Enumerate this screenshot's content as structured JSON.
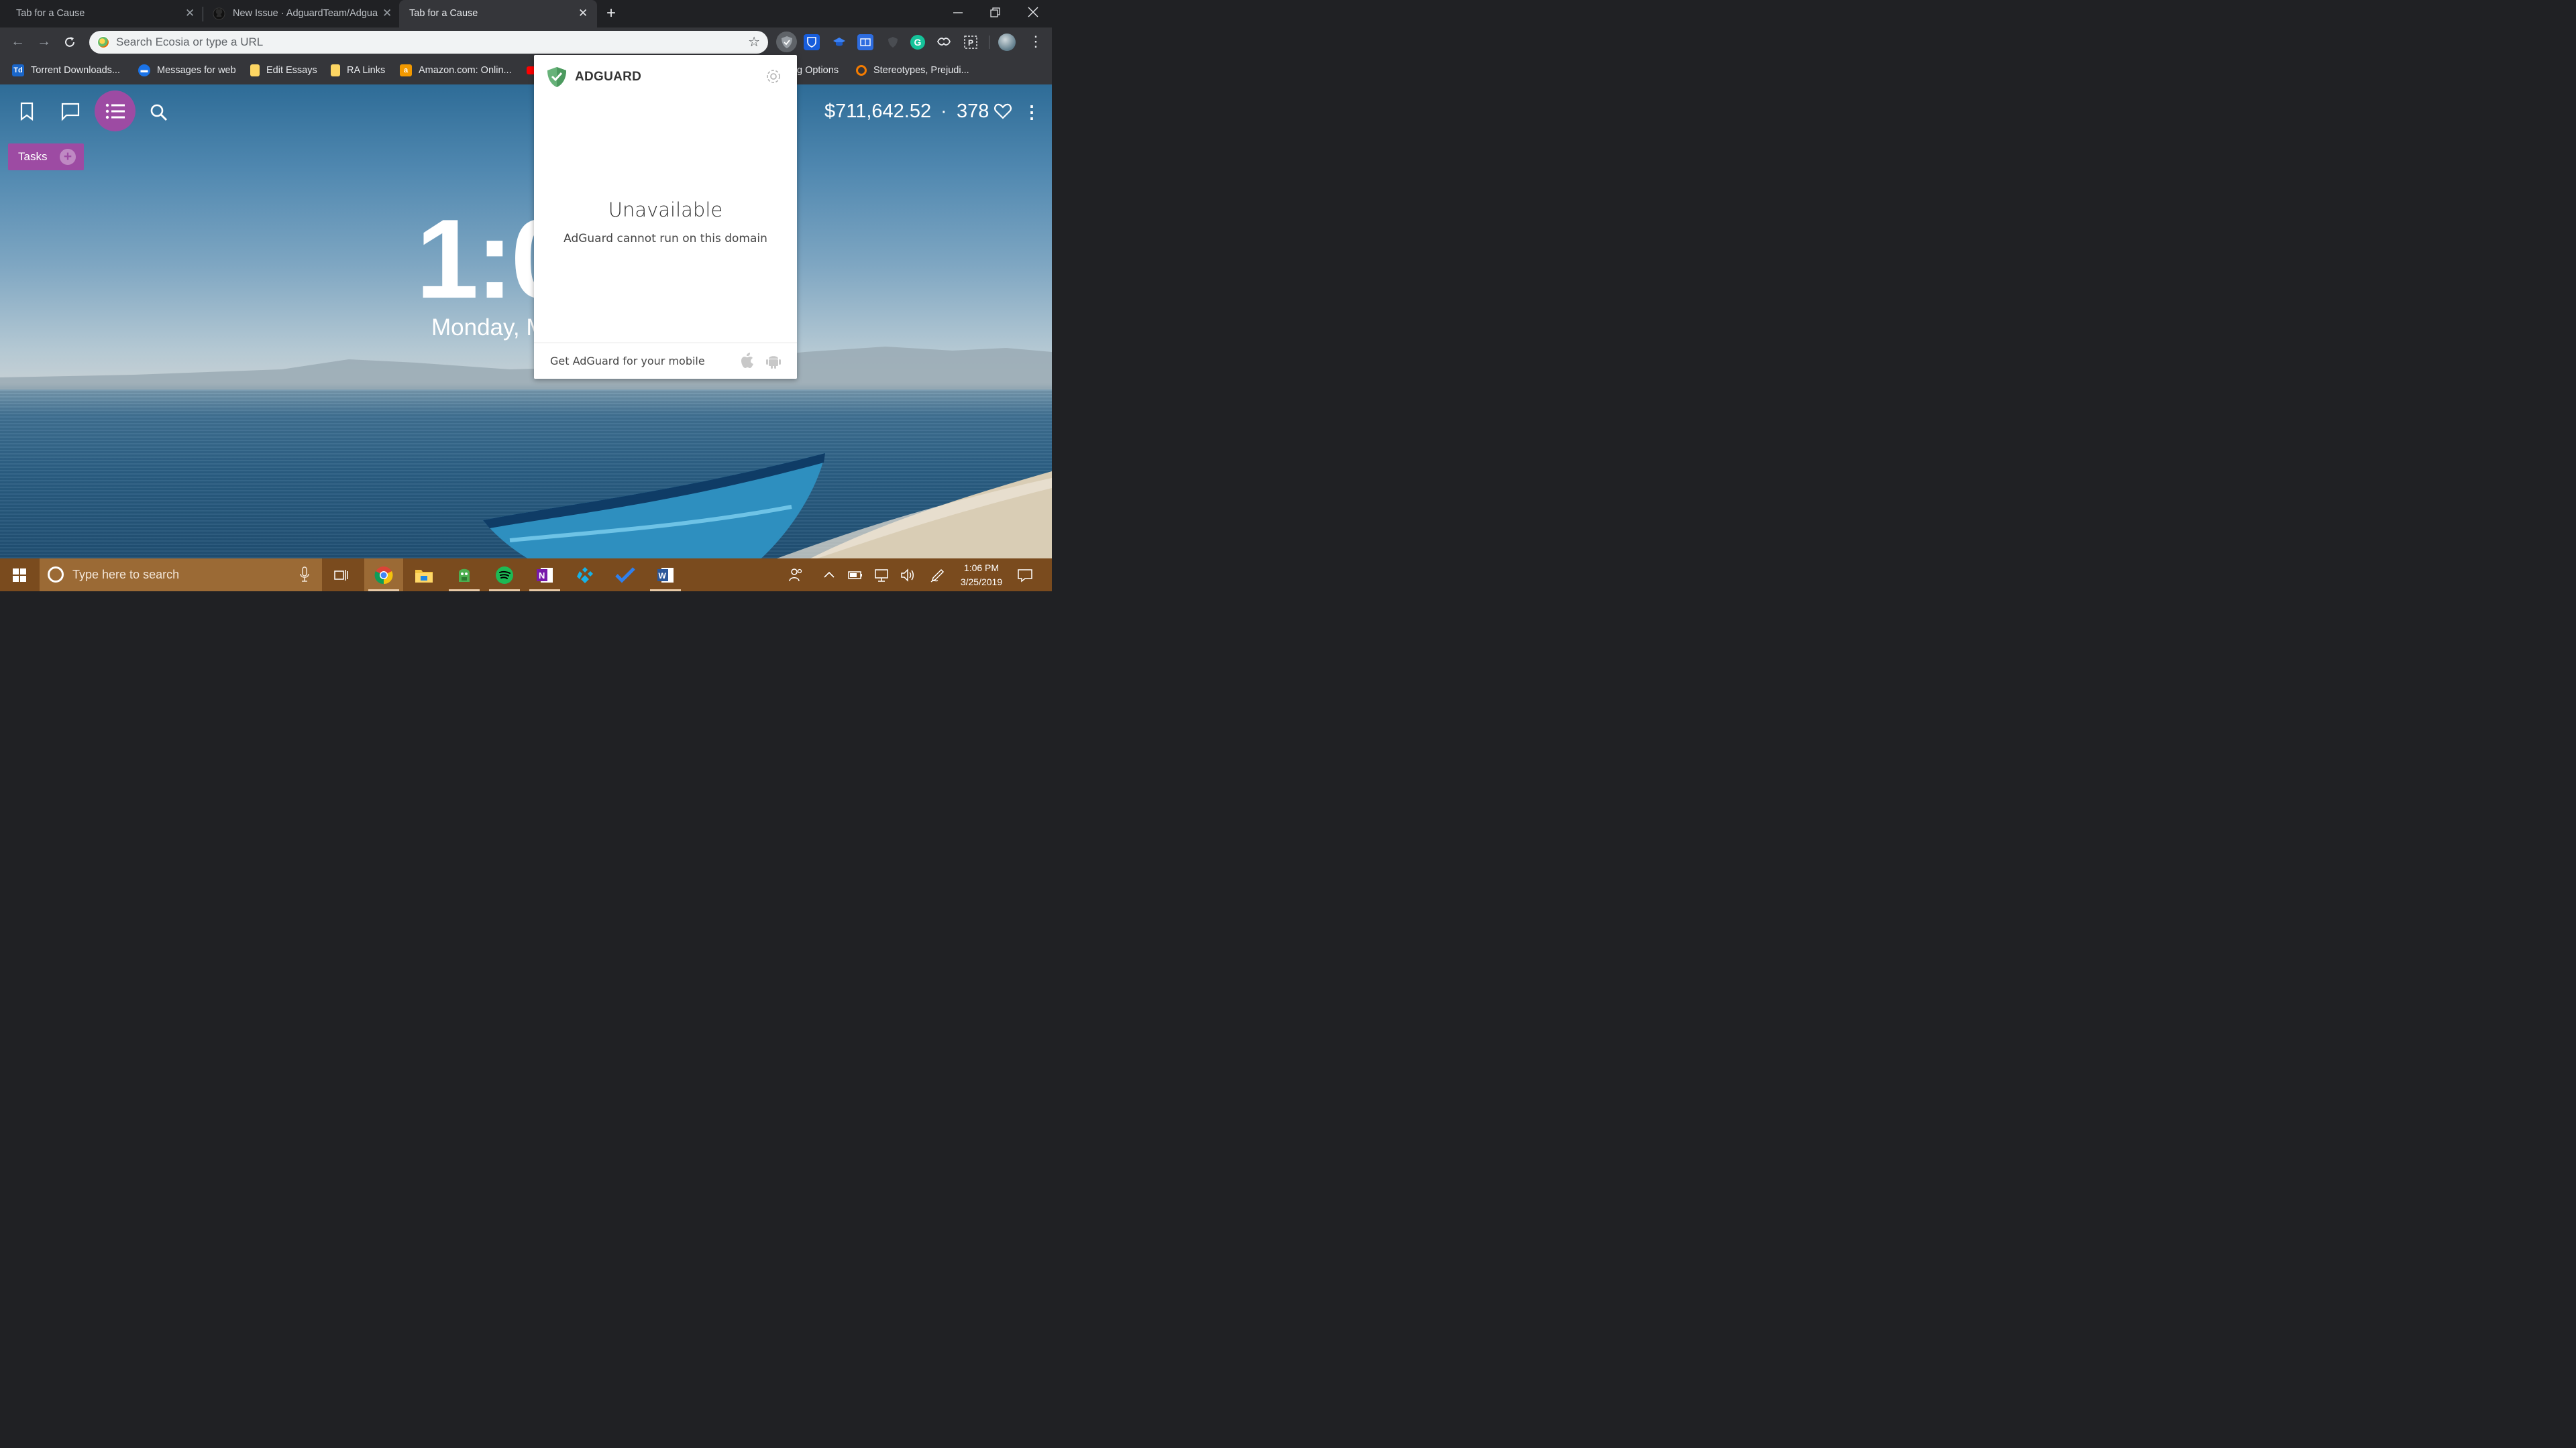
{
  "browser": {
    "tabs": [
      {
        "title": "Tab for a Cause",
        "active": false
      },
      {
        "title": "New Issue · AdguardTeam/Adgua",
        "active": false
      },
      {
        "title": "Tab for a Cause",
        "active": true
      }
    ],
    "omnibox": {
      "placeholder": "Search Ecosia or type a URL",
      "value": ""
    },
    "extensions": [
      "adguard-icon",
      "bitwarden-icon",
      "graduation-cap-icon",
      "reader-icon",
      "shield-icon",
      "grammarly-icon",
      "handshake-icon",
      "parking-icon"
    ],
    "bookmarks": [
      {
        "label": "Torrent Downloads...",
        "icon": "Td",
        "color": "#1a66c9"
      },
      {
        "label": "Messages for web",
        "icon": "m",
        "color": "#1a73e8"
      },
      {
        "label": "Edit Essays",
        "icon": "",
        "color": "#fdd663"
      },
      {
        "label": "RA Links",
        "icon": "",
        "color": "#fdd663"
      },
      {
        "label": "Amazon.com: Onlin...",
        "icon": "a",
        "color": "#f29900"
      },
      {
        "label": "g Options",
        "icon": "",
        "color": ""
      },
      {
        "label": "Stereotypes, Prejudi...",
        "icon": "",
        "color": "#f57c00"
      }
    ]
  },
  "page": {
    "tasks_label": "Tasks",
    "money_raised": "$711,642.52",
    "separator": "·",
    "hearts": "378",
    "clock": "1:0",
    "date": "Monday, M"
  },
  "adguard": {
    "brand": "ADGUARD",
    "status_title": "Unavailable",
    "status_message": "AdGuard cannot run on this domain",
    "mobile_cta": "Get AdGuard for your mobile",
    "accent": "#67b279"
  },
  "taskbar": {
    "search_placeholder": "Type here to search",
    "time": "1:06 PM",
    "date": "3/25/2019",
    "apps": [
      "chrome-icon",
      "file-explorer-icon",
      "vpn-icon",
      "spotify-icon",
      "onenote-icon",
      "kodi-icon",
      "todo-icon",
      "word-icon"
    ]
  }
}
